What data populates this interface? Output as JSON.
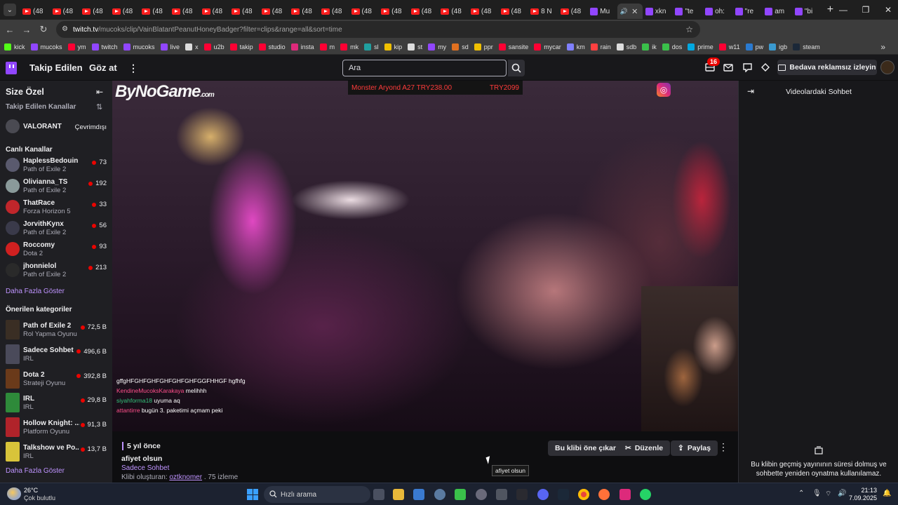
{
  "browser": {
    "tabs": [
      {
        "label": "(48",
        "favicon": "youtube-favicon"
      },
      {
        "label": "(48",
        "favicon": "youtube-favicon"
      },
      {
        "label": "(48",
        "favicon": "youtube-favicon"
      },
      {
        "label": "(48",
        "favicon": "youtube-favicon"
      },
      {
        "label": "(48",
        "favicon": "youtube-favicon"
      },
      {
        "label": "(48",
        "favicon": "youtube-favicon"
      },
      {
        "label": "(48",
        "favicon": "youtube-favicon"
      },
      {
        "label": "(48",
        "favicon": "youtube-favicon"
      },
      {
        "label": "(48",
        "favicon": "youtube-favicon"
      },
      {
        "label": "(48",
        "favicon": "youtube-favicon"
      },
      {
        "label": "(48",
        "favicon": "youtube-favicon"
      },
      {
        "label": "(48",
        "favicon": "youtube-favicon"
      },
      {
        "label": "(48",
        "favicon": "youtube-favicon"
      },
      {
        "label": "(48",
        "favicon": "youtube-favicon"
      },
      {
        "label": "(48",
        "favicon": "youtube-favicon"
      },
      {
        "label": "(48",
        "favicon": "youtube-favicon"
      },
      {
        "label": "(48",
        "favicon": "youtube-favicon"
      },
      {
        "label": "8 N",
        "favicon": "youtube-favicon"
      },
      {
        "label": "(48",
        "favicon": "youtube-favicon"
      },
      {
        "label": "Mu",
        "favicon": "twitch-favicon"
      }
    ],
    "active_tab": {
      "label": "",
      "favicon": "speaker-icon"
    },
    "right_tabs": [
      {
        "label": "xkn",
        "favicon": "twitch-favicon"
      },
      {
        "label": "\"te",
        "favicon": "twitch-favicon"
      },
      {
        "label": "oh:",
        "favicon": "twitch-favicon"
      },
      {
        "label": "\"re",
        "favicon": "twitch-favicon"
      },
      {
        "label": "am",
        "favicon": "twitch-favicon"
      },
      {
        "label": "\"bi",
        "favicon": "twitch-favicon"
      }
    ],
    "url_host": "twitch.tv",
    "url_path": "/mucoks/clip/VainBlatantPeanutHoneyBadger?filter=clips&range=all&sort=time",
    "bookmarks": [
      "kick",
      "mucoks",
      "ym",
      "twitch",
      "mucoks",
      "live",
      "x",
      "u2b",
      "takip",
      "studio",
      "insta",
      "m",
      "mk",
      "sl",
      "kip",
      "st",
      "my",
      "sd",
      "ppr",
      "sansite",
      "mycar",
      "km",
      "rain",
      "sdb",
      "ik",
      "dos",
      "prime",
      "w11",
      "pw",
      "igb",
      "steam"
    ]
  },
  "twitch": {
    "nav_following": "Takip Edilen",
    "nav_browse": "Göz at",
    "search_placeholder": "Ara",
    "notifications_count": "16",
    "adfree_label": "Bedava reklamsız izleyin"
  },
  "sidebar": {
    "title": "Size Özel",
    "followed_header": "Takip Edilen Kanallar",
    "followed": {
      "name": "VALORANT",
      "status": "Çevrimdışı"
    },
    "live_header": "Canlı Kanallar",
    "live_channels": [
      {
        "name": "HaplessBedouin",
        "game": "Path of Exile 2",
        "viewers": "73",
        "color": "#5a5a6e"
      },
      {
        "name": "Olivianna_TS",
        "game": "Path of Exile 2",
        "viewers": "192",
        "color": "#8a9a9a"
      },
      {
        "name": "ThatRace",
        "game": "Forza Horizon 5",
        "viewers": "33",
        "color": "#c0262b"
      },
      {
        "name": "JorvithKynx",
        "game": "Path of Exile 2",
        "viewers": "56",
        "color": "#3a3a4a"
      },
      {
        "name": "Roccomy",
        "game": "Dota 2",
        "viewers": "93",
        "color": "#d02020"
      },
      {
        "name": "jhonnielol",
        "game": "Path of Exile 2",
        "viewers": "213",
        "color": "#2a2a2a"
      }
    ],
    "show_more": "Daha Fazla Göster",
    "categories_header": "Önerilen kategoriler",
    "categories": [
      {
        "name": "Path of Exile 2",
        "genre": "Rol Yapma Oyunu",
        "viewers": "72,5 B",
        "color": "#3a2e24"
      },
      {
        "name": "Sadece Sohbet",
        "genre": "IRL",
        "viewers": "496,6 B",
        "color": "#4a4a5a"
      },
      {
        "name": "Dota 2",
        "genre": "Strateji Oyunu",
        "viewers": "392,8 B",
        "color": "#6a3a1a"
      },
      {
        "name": "IRL",
        "genre": "IRL",
        "viewers": "29,8 B",
        "color": "#2e8a3a"
      },
      {
        "name": "Hollow Knight: ...",
        "genre": "Platform Oyunu",
        "viewers": "91,3 B",
        "color": "#b0232a"
      },
      {
        "name": "Talkshow ve Po...",
        "genre": "IRL",
        "viewers": "13,7 B",
        "color": "#d8c43a"
      }
    ],
    "show_more_2": "Daha Fazla Göster"
  },
  "video": {
    "brand": "ByNoGame",
    "brand_suffix": ".com",
    "ticker_item": "Monster Aryond A27 TRY238.00",
    "ticker_price": "TRY2099",
    "overlay_chat": [
      {
        "user": "",
        "text": "gffgHFGHFGHFGHFGHFGHFGGFHHGF hgfhfg"
      },
      {
        "user": "KendineMucoksKarakaya",
        "text": "melihhh"
      },
      {
        "user": "siyahforma18",
        "text": "uyuma aq"
      },
      {
        "user": "attantirre",
        "text": "bugün 3. paketimi açmam peki"
      }
    ]
  },
  "clip": {
    "ago": "5 yıl önce",
    "title": "afiyet olsun",
    "category": "Sadece Sohbet",
    "created_by_label": "Klibi oluşturan:",
    "creator": "oztknomer",
    "views": ". 75 izleme",
    "feature_btn": "Bu klibi öne çıkar",
    "edit_btn": "Düzenle",
    "share_btn": "Paylaş",
    "tooltip": "afiyet olsun"
  },
  "chat": {
    "title": "Videolardaki Sohbet",
    "message": "Bu klibin geçmiş yayınının süresi dolmuş ve sohbette yeniden oynatma kullanılamaz."
  },
  "taskbar": {
    "temp": "26°C",
    "weather": "Çok bulutlu",
    "search": "Hızlı arama",
    "time": "21:13",
    "date": "7.09.2025"
  },
  "colors": {
    "twitch_purple": "#9146ff",
    "link_purple": "#bf94ff",
    "live_red": "#eb0400"
  }
}
